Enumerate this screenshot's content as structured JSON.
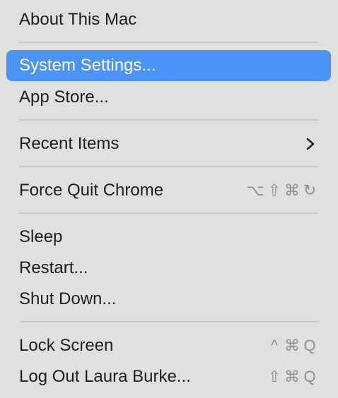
{
  "menu": {
    "items": [
      {
        "label": "About This Mac"
      },
      {
        "label": "System Settings..."
      },
      {
        "label": "App Store..."
      },
      {
        "label": "Recent Items"
      },
      {
        "label": "Force Quit Chrome",
        "shortcut": [
          "⌥",
          "⇧",
          "⌘",
          "↻"
        ]
      },
      {
        "label": "Sleep"
      },
      {
        "label": "Restart..."
      },
      {
        "label": "Shut Down..."
      },
      {
        "label": "Lock Screen",
        "shortcut": [
          "^",
          "⌘",
          "Q"
        ]
      },
      {
        "label": "Log Out Laura Burke...",
        "shortcut": [
          "⇧",
          "⌘",
          "Q"
        ]
      }
    ],
    "highlight_color": "#4b93f6",
    "background_color": "#e0e0e0"
  }
}
